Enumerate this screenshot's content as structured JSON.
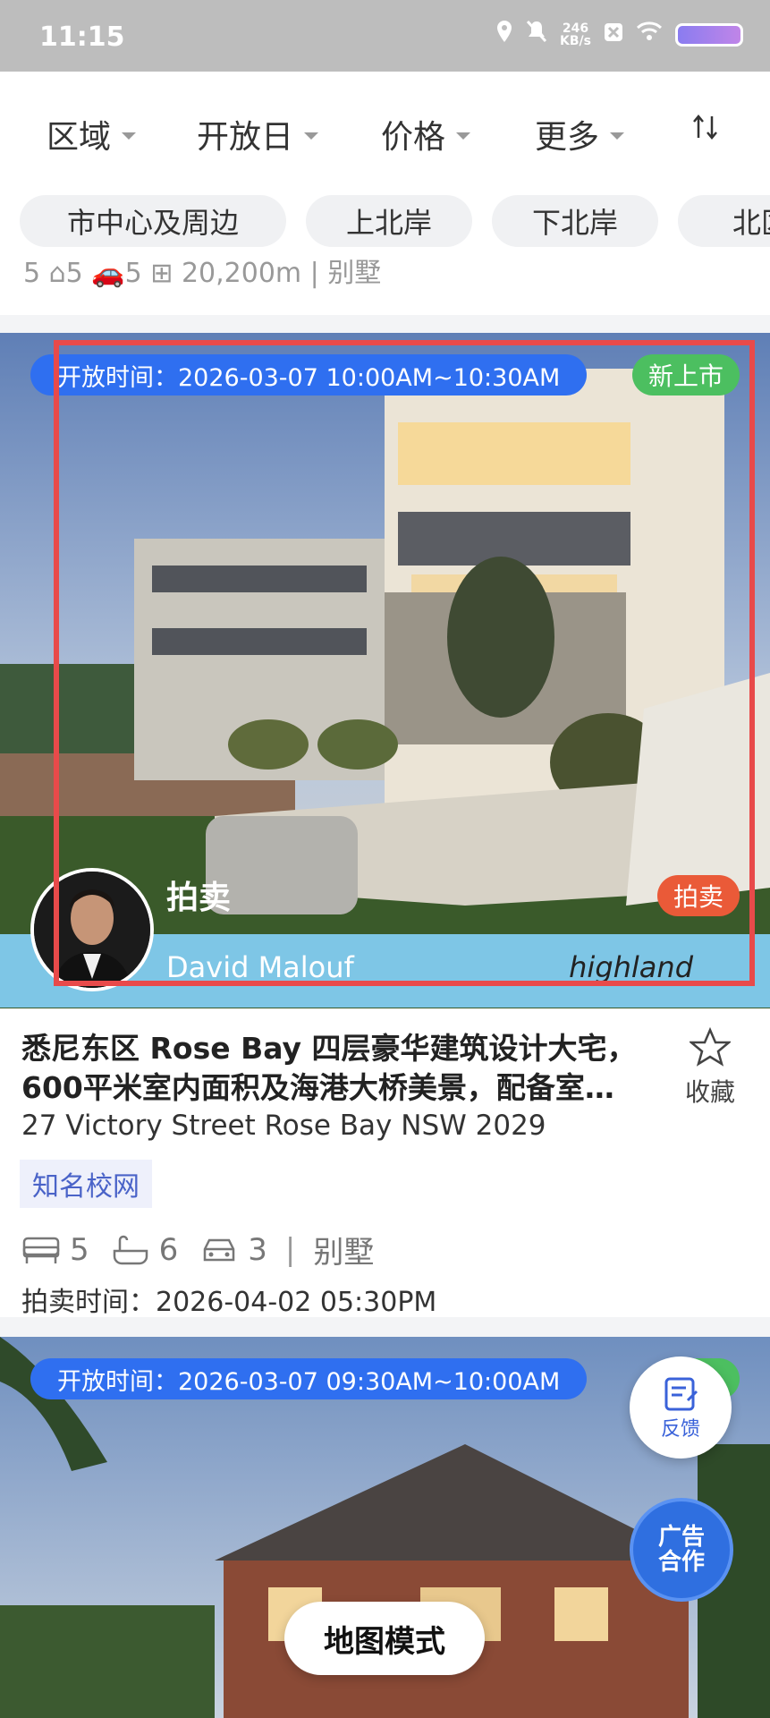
{
  "status_bar": {
    "time": "11:15",
    "net_speed_value": "246",
    "net_speed_unit": "KB/s"
  },
  "filters": [
    {
      "label": "区域"
    },
    {
      "label": "开放日"
    },
    {
      "label": "价格"
    },
    {
      "label": "更多"
    }
  ],
  "chips": [
    "市中心及周边",
    "上北岸",
    "下北岸",
    "北区"
  ],
  "previous_card_partial": "5  ⌂5  🚗5  ⊞ 20,200m  |  别墅",
  "listings": [
    {
      "open_time": "开放时间：2026-03-07 10:00AM~10:30AM",
      "badge": "新上市",
      "auction_label": "拍卖",
      "auction_badge": "拍卖",
      "agent_name": "David Malouf",
      "agency": "highland",
      "title": "悉尼东区 Rose Bay 四层豪华建筑设计大宅，600平米室内面积及海港大桥美景，配备室…",
      "address": "27 Victory Street Rose Bay NSW 2029",
      "tag": "知名校网",
      "bedrooms": "5",
      "bathrooms": "6",
      "parking": "3",
      "property_type": "别墅",
      "auction_time": "拍卖时间：2026-04-02 05:30PM",
      "favorite_label": "收藏"
    },
    {
      "open_time": "开放时间：2026-03-07 09:30AM~10:00AM"
    }
  ],
  "fab": {
    "feedback": "反馈",
    "ad_line1": "广告",
    "ad_line2": "合作"
  },
  "map_mode": "地图模式",
  "colors": {
    "accent": "#2f6ff0",
    "new_badge": "#4cbf60",
    "auction_badge": "#ea5a38",
    "highlight": "#e84a4a"
  }
}
